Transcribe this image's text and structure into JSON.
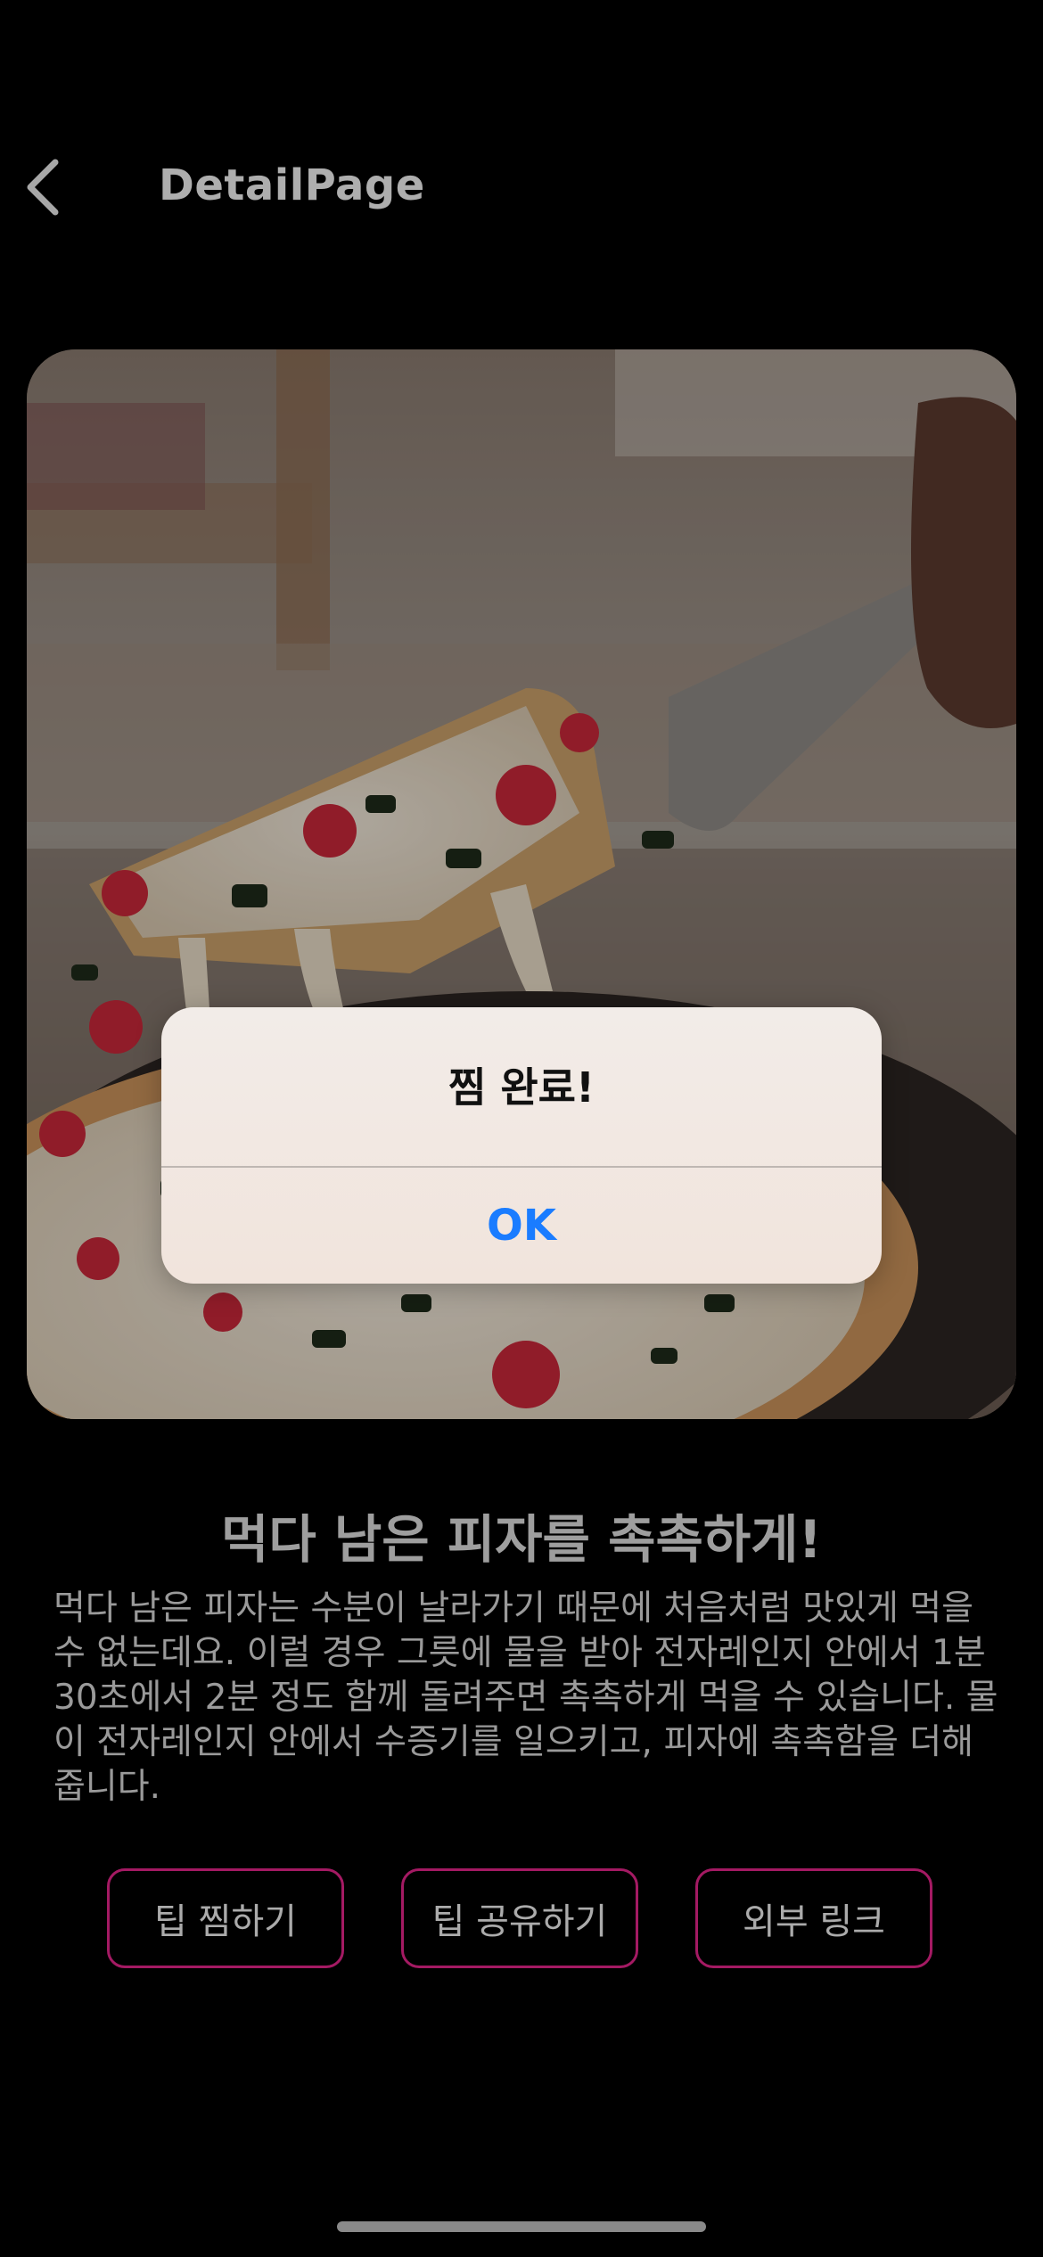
{
  "header": {
    "title": "DetailPage",
    "back_icon": "chevron-left-icon"
  },
  "hero": {
    "image_desc": "pizza-slice-photo"
  },
  "tip": {
    "title": "먹다 남은 피자를 촉촉하게!",
    "body": "먹다 남은 피자는 수분이 날라가기 때문에 처음처럼 맛있게 먹을 수 없는데요. 이럴 경우 그릇에 물을 받아 전자레인지 안에서 1분 30초에서 2분 정도 함께 돌려주면 촉촉하게 먹을 수 있습니다. 물이 전자레인지 안에서 수증기를 일으키고, 피자에 촉촉함을 더해줍니다."
  },
  "buttons": {
    "save": "팁 찜하기",
    "share": "팁 공유하기",
    "link": "외부 링크"
  },
  "alert": {
    "title": "찜 완료!",
    "ok": "OK"
  },
  "colors": {
    "background": "#000000",
    "accent": "#e3248a",
    "alert_button": "#1a7cff"
  }
}
